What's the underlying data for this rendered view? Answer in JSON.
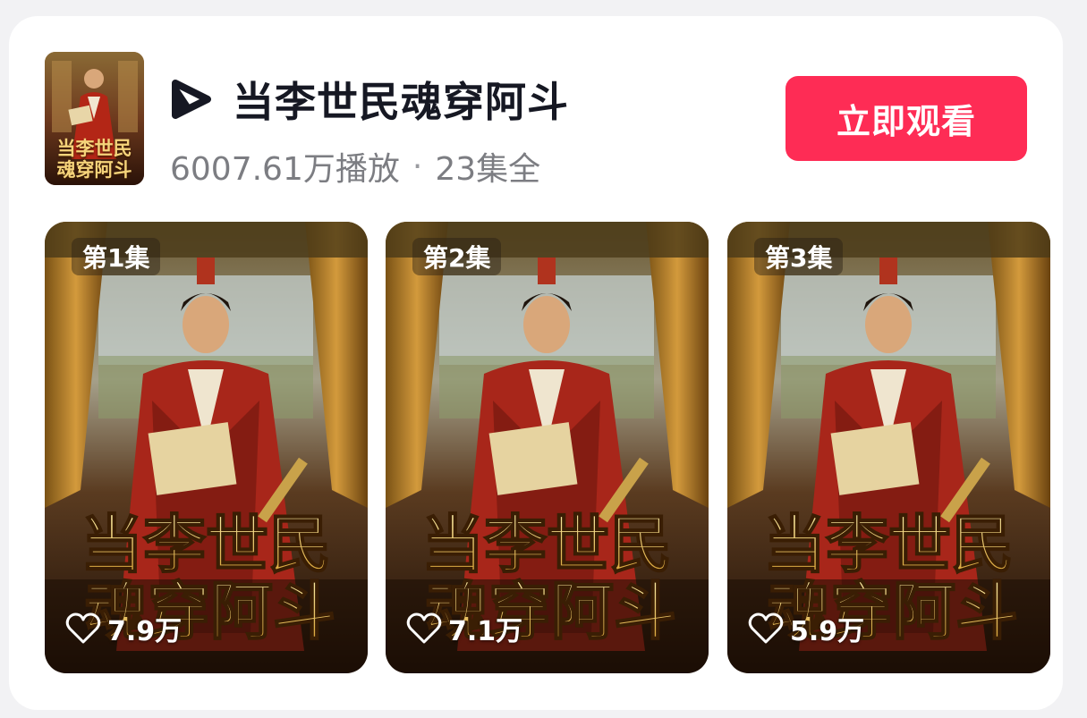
{
  "drama": {
    "title": "当李世民魂穿阿斗",
    "plays": "6007.61万播放",
    "separator": "·",
    "episodes_total": "23集全",
    "poster_text_line1": "当李世民",
    "poster_text_line2": "魂穿阿斗",
    "brand_icon": "play-triangle-logo-icon"
  },
  "actions": {
    "watch_label": "立即观看"
  },
  "colors": {
    "accent": "#fe2c55",
    "title_text": "#161823",
    "meta_text": "#7c7d82",
    "background": "#f2f2f4",
    "card": "#ffffff"
  },
  "episodes": [
    {
      "label": "第1集",
      "likes": "7.9万",
      "like_icon": "heart-outline-icon"
    },
    {
      "label": "第2集",
      "likes": "7.1万",
      "like_icon": "heart-outline-icon"
    },
    {
      "label": "第3集",
      "likes": "5.9万",
      "like_icon": "heart-outline-icon"
    }
  ]
}
